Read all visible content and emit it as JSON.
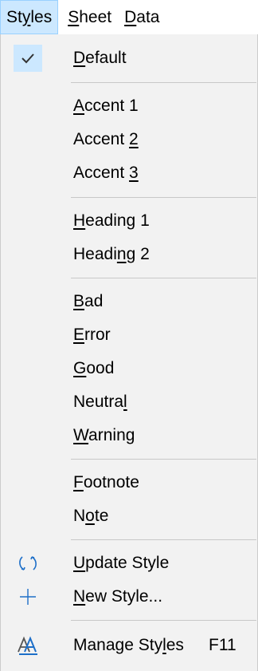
{
  "menubar": {
    "styles": {
      "pre": "St",
      "mn": "y",
      "post": "les"
    },
    "sheet": {
      "pre": "",
      "mn": "S",
      "post": "heet"
    },
    "data": {
      "pre": "",
      "mn": "D",
      "post": "ata"
    }
  },
  "menu": {
    "default": {
      "pre": "",
      "mn": "D",
      "post": "efault"
    },
    "accent1": {
      "pre": "",
      "mn": "A",
      "post": "ccent 1"
    },
    "accent2": {
      "pre": "Accent ",
      "mn": "2",
      "post": ""
    },
    "accent3": {
      "pre": "Accent ",
      "mn": "3",
      "post": ""
    },
    "heading1": {
      "pre": "",
      "mn": "H",
      "post": "eading 1"
    },
    "heading2": {
      "pre": "Headi",
      "mn": "n",
      "post": "g 2"
    },
    "bad": {
      "pre": "",
      "mn": "B",
      "post": "ad"
    },
    "error": {
      "pre": "",
      "mn": "E",
      "post": "rror"
    },
    "good": {
      "pre": "",
      "mn": "G",
      "post": "ood"
    },
    "neutral": {
      "pre": "Neutra",
      "mn": "l",
      "post": ""
    },
    "warning": {
      "pre": "",
      "mn": "W",
      "post": "arning"
    },
    "footnote": {
      "pre": "",
      "mn": "F",
      "post": "ootnote"
    },
    "note": {
      "pre": "N",
      "mn": "o",
      "post": "te"
    },
    "update_style": {
      "pre": "",
      "mn": "U",
      "post": "pdate Style"
    },
    "new_style": {
      "pre": "",
      "mn": "N",
      "post": "ew Style..."
    },
    "manage_styles": {
      "pre": "Manage Sty",
      "mn": "l",
      "post": "es",
      "shortcut": "F11"
    }
  },
  "icons": {
    "checked": "checkmark-icon",
    "update": "refresh-icon",
    "new": "plus-icon",
    "manage": "styles-manager-icon"
  },
  "colors": {
    "highlight": "#cce8ff",
    "highlight_border": "#99d1ff",
    "icon_blue": "#1e6fc8",
    "panel_bg": "#f2f2f2"
  }
}
